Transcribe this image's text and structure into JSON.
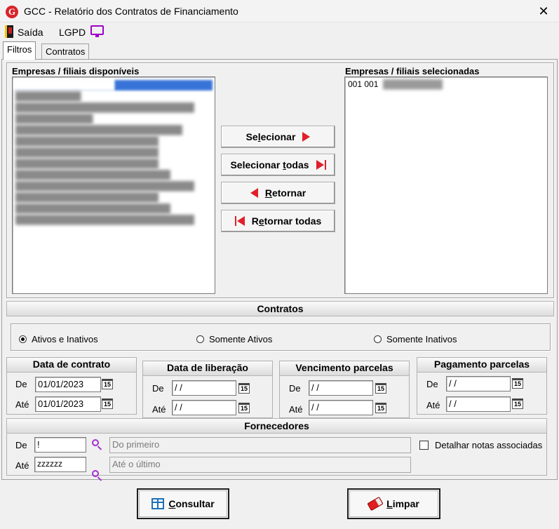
{
  "window": {
    "title": "GCC - Relatório dos Contratos de Financiamento",
    "app_icon_letter": "G",
    "close_glyph": "✕"
  },
  "toolbar": {
    "exit_label": "Saída",
    "lgpd_label": "LGPD"
  },
  "tabs": [
    {
      "label": "Filtros",
      "active": true
    },
    {
      "label": "Contratos",
      "active": false
    }
  ],
  "companies": {
    "available_label": "Empresas / filiais disponíveis",
    "selected_label": "Empresas / filiais selecionadas",
    "selected_items": [
      {
        "code": "001 001"
      }
    ],
    "buttons": {
      "select": {
        "pre": "Se",
        "accel": "l",
        "post": "ecionar"
      },
      "select_all": {
        "pre": "Selecionar ",
        "accel": "t",
        "post": "odas"
      },
      "return": {
        "pre": "",
        "accel": "R",
        "post": "etornar"
      },
      "return_all": {
        "pre": "R",
        "accel": "e",
        "post": "tornar todas"
      }
    }
  },
  "contracts": {
    "header": "Contratos",
    "options": [
      {
        "label": "Ativos e Inativos",
        "checked": true
      },
      {
        "label": "Somente Ativos",
        "checked": false
      },
      {
        "label": "Somente Inativos",
        "checked": false
      }
    ]
  },
  "dates": {
    "de_label": "De",
    "ate_label": "Até",
    "calendar_glyph": "15",
    "contract": {
      "title": "Data de contrato",
      "from": "01/01/2023",
      "to": "01/01/2023"
    },
    "release": {
      "title": "Data de liberação",
      "from": " / /",
      "to": " / /"
    },
    "due": {
      "title": "Vencimento parcelas",
      "from": " / /",
      "to": " / /"
    },
    "payment": {
      "title": "Pagamento parcelas",
      "from": " / /",
      "to": " / /"
    }
  },
  "suppliers": {
    "header": "Fornecedores",
    "de_label": "De",
    "ate_label": "Até",
    "from_code": "!",
    "from_name": "Do primeiro",
    "to_code": "zzzzzz",
    "to_name": "Até o último",
    "detail_label": "Detalhar notas associadas",
    "detail_checked": false
  },
  "actions": {
    "query": {
      "accel": "C",
      "post": "onsultar"
    },
    "clear": {
      "accel": "L",
      "post": "impar"
    }
  }
}
